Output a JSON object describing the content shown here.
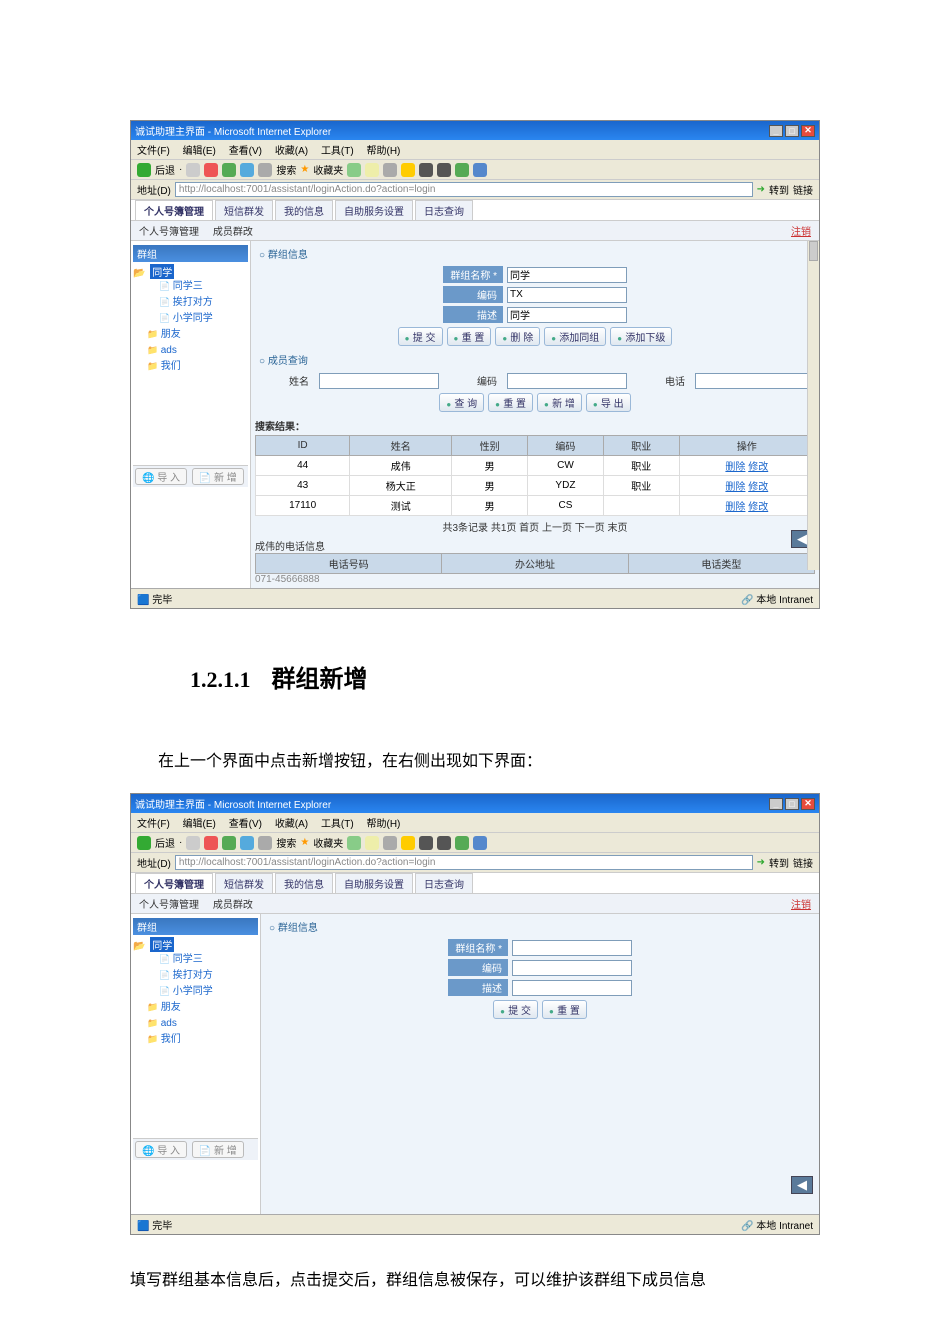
{
  "section": {
    "number": "1.2.1.1",
    "title": "群组新增"
  },
  "intro_text": "在上一个界面中点击新增按钮，在右侧出现如下界面：",
  "outro_text": "填写群组基本信息后，点击提交后，群组信息被保存，可以维护该群组下成员信息",
  "window": {
    "title": "诚试助理主界面 - Microsoft Internet Explorer",
    "menus": [
      "文件(F)",
      "编辑(E)",
      "查看(V)",
      "收藏(A)",
      "工具(T)",
      "帮助(H)"
    ],
    "toolbar": {
      "back": "后退",
      "search": "搜索",
      "favorites": "收藏夹"
    },
    "address_label": "地址(D)",
    "url": "http://localhost:7001/assistant/loginAction.do?action=login",
    "go": "转到",
    "links": "链接",
    "tabs": [
      "个人号簿管理",
      "短信群发",
      "我的信息",
      "自助服务设置",
      "日志查询"
    ],
    "subtabs": {
      "a": "个人号簿管理",
      "b": "成员群改"
    },
    "logout": "注销",
    "status_done": "完毕",
    "status_intranet": "本地 Intranet"
  },
  "tree": {
    "header": "群组",
    "root": "同学",
    "items_sub": [
      "同学三",
      "挨打对方",
      "小学同学"
    ],
    "items": [
      "朋友",
      "ads",
      "我们"
    ]
  },
  "tree_footer": {
    "import": "导 入",
    "add": "新 增"
  },
  "panel1": {
    "title_group": "群组信息",
    "label_name": "群组名称 *",
    "val_name": "同学",
    "label_code": "编码",
    "val_code": "TX",
    "label_desc": "描述",
    "val_desc": "同学",
    "btns": [
      "提 交",
      "重 置",
      "删 除",
      "添加同组",
      "添加下级"
    ]
  },
  "panel2": {
    "title_query": "成员查询",
    "label_name": "姓名",
    "label_code": "编码",
    "label_phone": "电话",
    "btns": [
      "查 询",
      "重 置",
      "新 增",
      "导 出"
    ]
  },
  "table": {
    "label": "搜索结果：",
    "headers": [
      "ID",
      "姓名",
      "性别",
      "编码",
      "职业",
      "操作"
    ],
    "rows": [
      {
        "id": "44",
        "name": "成伟",
        "sex": "男",
        "code": "CW",
        "job": "职业",
        "ops": [
          "删除",
          "修改"
        ]
      },
      {
        "id": "43",
        "name": "杨大正",
        "sex": "男",
        "code": "YDZ",
        "job": "职业",
        "ops": [
          "删除",
          "修改"
        ]
      },
      {
        "id": "17110",
        "name": "测试",
        "sex": "男",
        "code": "CS",
        "job": "",
        "ops": [
          "删除",
          "修改"
        ]
      }
    ],
    "pager": "共3条记录  共1页  首页  上一页  下一页  末页"
  },
  "phone": {
    "title": "成伟的电话信息",
    "headers": [
      "电话号码",
      "办公地址",
      "电话类型"
    ],
    "row0": "071-45666888"
  },
  "panel_add": {
    "title_group": "群组信息",
    "label_name": "群组名称 *",
    "label_code": "编码",
    "label_desc": "描述",
    "btns": [
      "提 交",
      "重 置"
    ]
  }
}
